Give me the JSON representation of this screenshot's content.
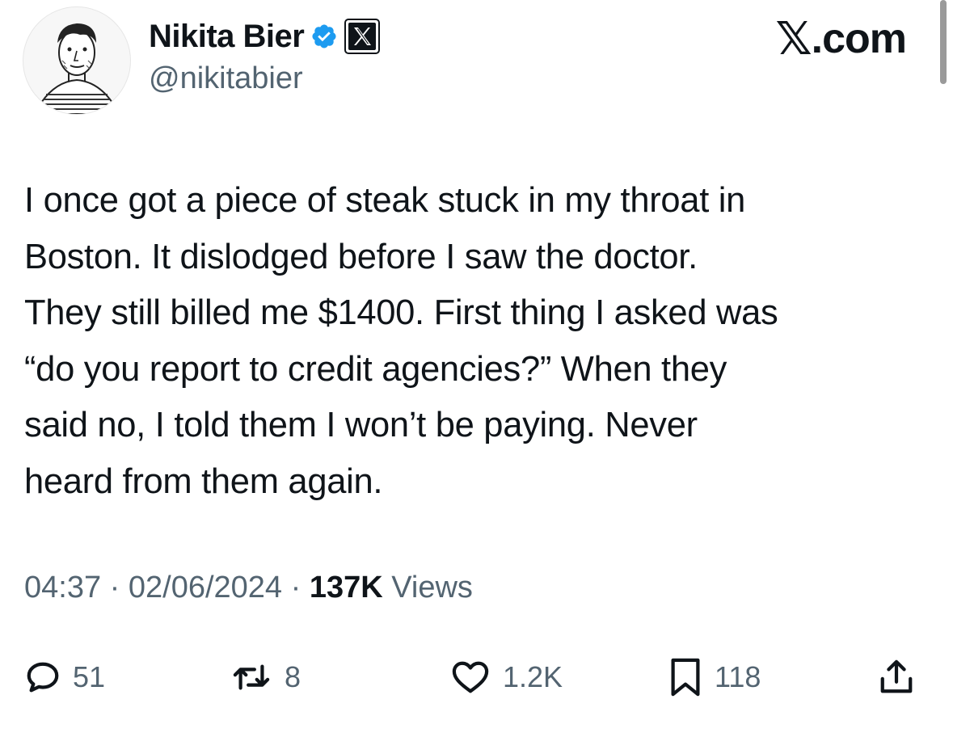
{
  "author": {
    "display_name": "Nikita Bier",
    "handle": "@nikitabier",
    "avatar_icon": "avatar-sketch",
    "verified_icon": "verified-badge-icon",
    "affiliation_icon": "x-logo-icon"
  },
  "brand": {
    "mark": "𝕏",
    "suffix": ".com"
  },
  "tweet": {
    "lines": [
      "I once got a piece of steak stuck in my throat in",
      "Boston. It dislodged before I saw the doctor.",
      "They still billed me $1400. First thing I asked was",
      "“do you report to credit agencies?” When they",
      "said no, I told them I won’t be paying. Never",
      "heard from them again."
    ]
  },
  "meta": {
    "time": "04:37",
    "separator": " · ",
    "date": "02/06/2024",
    "views_count": "137K",
    "views_label": " Views"
  },
  "actions": {
    "replies": "51",
    "reposts": "8",
    "likes": "1.2K",
    "bookmarks": "118"
  },
  "colors": {
    "text": "#0f1419",
    "secondary": "#536471",
    "verified": "#1d9bf0"
  }
}
